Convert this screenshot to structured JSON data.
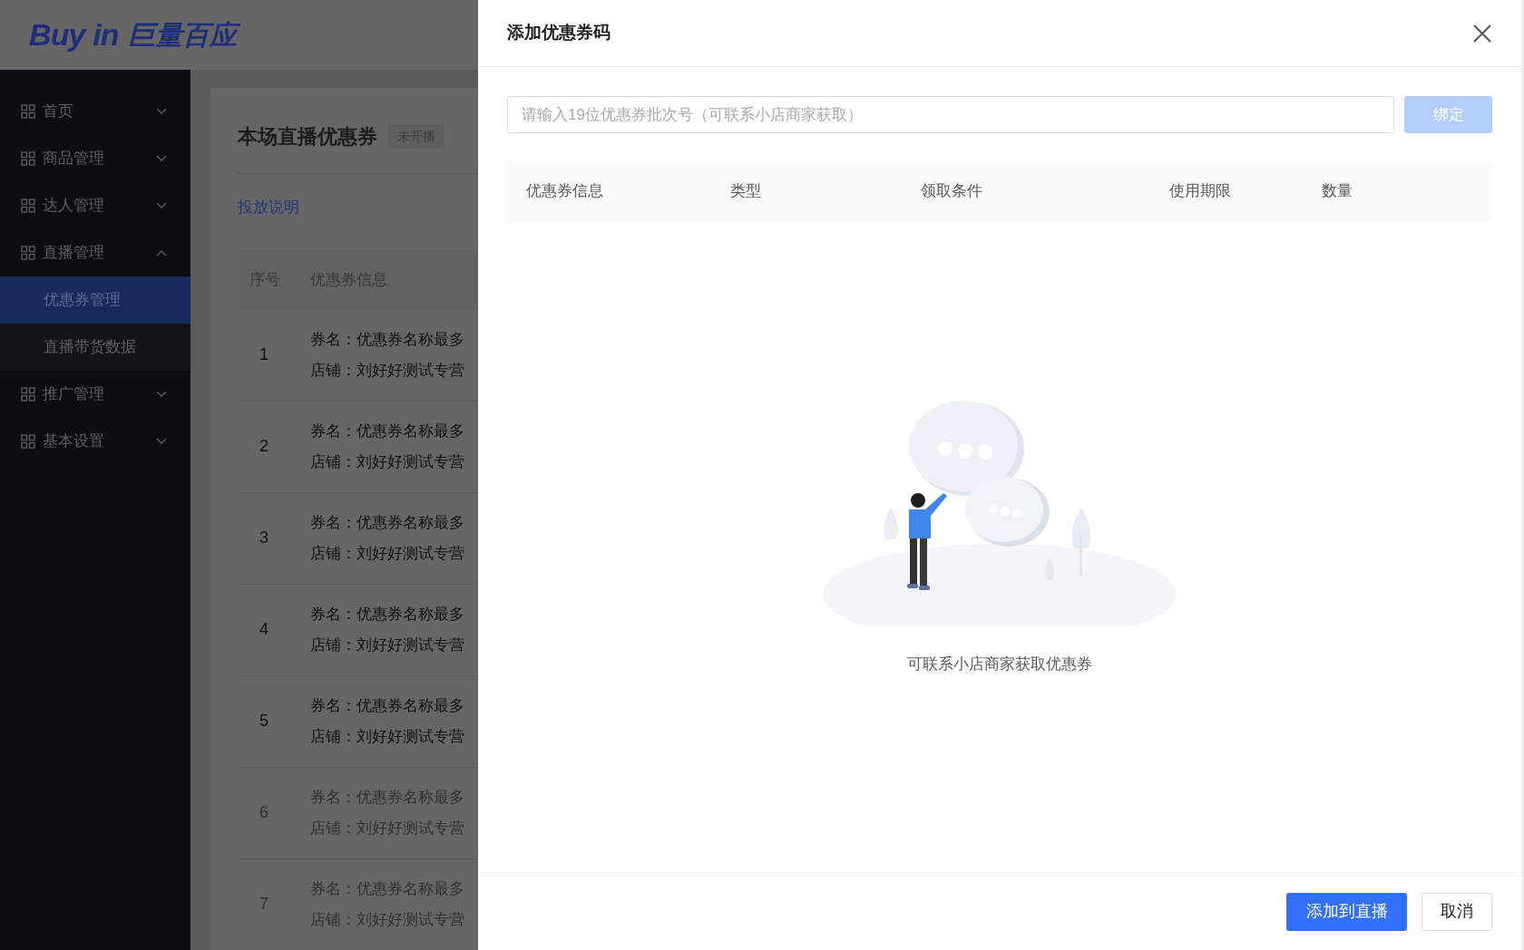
{
  "logo": {
    "latin": "Buy in",
    "chinese": "巨量百应"
  },
  "sidebar": {
    "items": [
      {
        "label": "首页",
        "expanded": false
      },
      {
        "label": "商品管理",
        "expanded": false
      },
      {
        "label": "达人管理",
        "expanded": false
      },
      {
        "label": "直播管理",
        "expanded": true,
        "children": [
          {
            "label": "优惠券管理",
            "selected": true
          },
          {
            "label": "直播带货数据",
            "selected": false
          }
        ]
      },
      {
        "label": "推广管理",
        "expanded": false
      },
      {
        "label": "基本设置",
        "expanded": false
      }
    ]
  },
  "page": {
    "title": "本场直播优惠券",
    "status": "未开播",
    "link": "投放说明",
    "table": {
      "columns": [
        "序号",
        "优惠券信息"
      ],
      "rows": [
        {
          "index": "1",
          "name": "券名：优惠券名称最多",
          "shop": "店铺：刘好好测试专营",
          "disabled": false
        },
        {
          "index": "2",
          "name": "券名：优惠券名称最多",
          "shop": "店铺：刘好好测试专营",
          "disabled": false
        },
        {
          "index": "3",
          "name": "券名：优惠券名称最多",
          "shop": "店铺：刘好好测试专营",
          "disabled": false
        },
        {
          "index": "4",
          "name": "券名：优惠券名称最多",
          "shop": "店铺：刘好好测试专营",
          "disabled": false
        },
        {
          "index": "5",
          "name": "券名：优惠券名称最多",
          "shop": "店铺：刘好好测试专营",
          "disabled": false
        },
        {
          "index": "6",
          "name": "券名：优惠券名称最多",
          "shop": "店铺：刘好好测试专营",
          "disabled": true
        },
        {
          "index": "7",
          "name": "券名：优惠券名称最多",
          "shop": "店铺：刘好好测试专营",
          "disabled": true
        }
      ]
    }
  },
  "drawer": {
    "title": "添加优惠券码",
    "search": {
      "placeholder": "请输入19位优惠券批次号（可联系小店商家获取）"
    },
    "bind_button": {
      "label": "绑定",
      "disabled": true
    },
    "table": {
      "columns": [
        "优惠券信息",
        "类型",
        "领取条件",
        "使用期限",
        "数量"
      ]
    },
    "empty_text": "可联系小店商家获取优惠券",
    "buttons": [
      {
        "label": "添加到直播",
        "kind": "primary"
      },
      {
        "label": "取消",
        "kind": "secondary"
      }
    ]
  }
}
